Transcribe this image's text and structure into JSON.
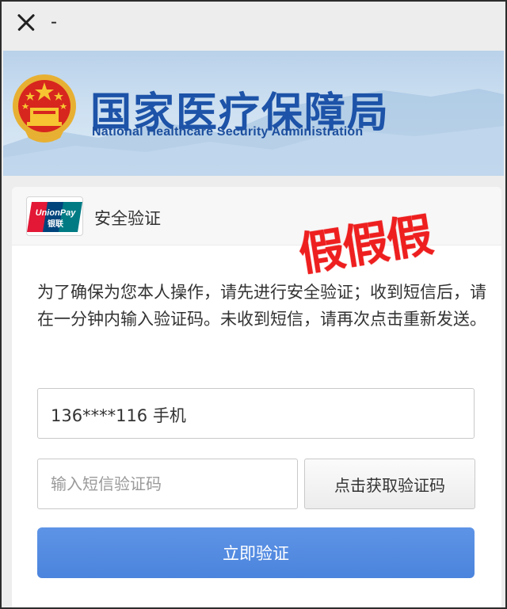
{
  "topbar": {
    "title": "-",
    "close_icon": "close-icon"
  },
  "banner": {
    "title_cn": "国家医疗保障局",
    "title_en": "National Healthcare Security Administration",
    "emblem_icon": "national-emblem-icon",
    "colors": {
      "title": "#1d53a8",
      "sky": "#c6dbef"
    }
  },
  "card": {
    "logo": {
      "line1": "UnionPay",
      "line2": "银联",
      "icon": "unionpay-logo"
    },
    "header_label": "安全验证",
    "description": "为了确保为您本人操作，请先进行安全验证；收到短信后，请在一分钟内输入验证码。未收到短信，请再次点击重新发送。",
    "phone_value": "136****116 手机",
    "code_placeholder": "输入短信验证码",
    "get_code_label": "点击获取验证码",
    "verify_label": "立即验证",
    "colors": {
      "primary_button": "#5289e0"
    }
  },
  "overlay": {
    "stamp_text": "假假假",
    "color": "#ee1f1f"
  }
}
